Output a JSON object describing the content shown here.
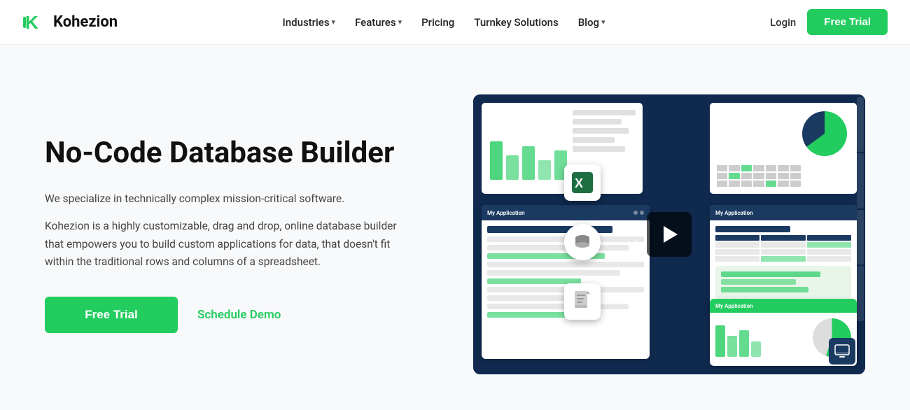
{
  "nav": {
    "logo_text": "Kohezion",
    "links": [
      {
        "label": "Industries",
        "has_dropdown": true
      },
      {
        "label": "Features",
        "has_dropdown": true
      },
      {
        "label": "Pricing",
        "has_dropdown": false
      },
      {
        "label": "Turnkey Solutions",
        "has_dropdown": false
      },
      {
        "label": "Blog",
        "has_dropdown": true
      }
    ],
    "login_label": "Login",
    "free_trial_label": "Free Trial"
  },
  "hero": {
    "title": "No-Code Database Builder",
    "subtitle": "We specialize in technically complex mission-critical software.",
    "body": "Kohezion is a highly customizable, drag and drop, online database builder that empowers you to build custom applications for data, that doesn't fit within the traditional rows and columns of a spreadsheet.",
    "cta_primary": "Free Trial",
    "cta_secondary": "Schedule Demo"
  }
}
